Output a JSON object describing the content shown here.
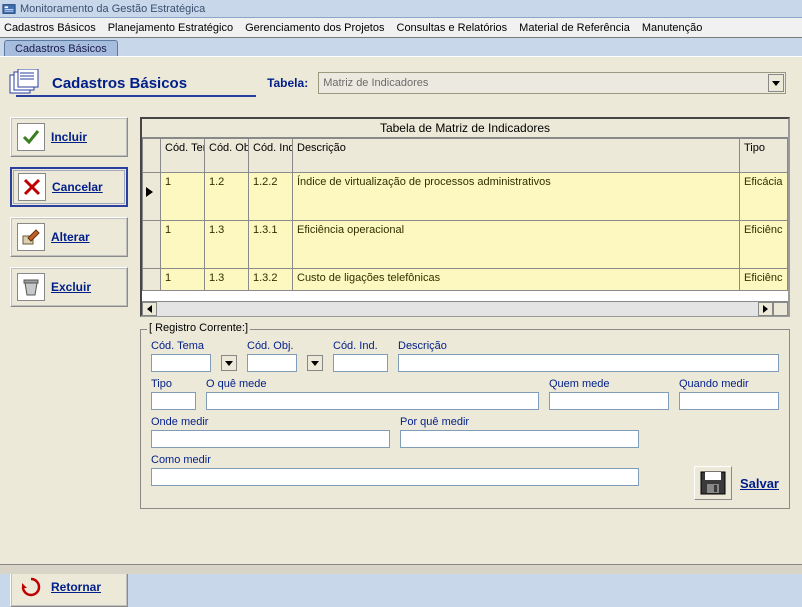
{
  "window": {
    "title": "Monitoramento da Gestão Estratégica"
  },
  "menu": {
    "items": [
      "Cadastros Básicos",
      "Planejamento Estratégico",
      "Gerenciamento dos Projetos",
      "Consultas e Relatórios",
      "Material de Referência",
      "Manutenção"
    ]
  },
  "tabstrip": {
    "active": "Cadastros Básicos"
  },
  "header": {
    "title": "Cadastros Básicos",
    "tabela_label": "Tabela:",
    "tabela_value": "Matriz de Indicadores"
  },
  "actions": {
    "incluir": "Incluir",
    "cancelar": "Cancelar",
    "alterar": "Alterar",
    "excluir": "Excluir",
    "retornar": "Retornar"
  },
  "table": {
    "title": "Tabela de Matriz de Indicadores",
    "columns": {
      "cod_tema": "Cód. Tema",
      "cod_obj": "Cód. Obj.",
      "cod_ind": "Cód. Ind.",
      "descricao": "Descrição",
      "tipo": "Tipo"
    },
    "rows": [
      {
        "cod_tema": "1",
        "cod_obj": "1.2",
        "cod_ind": "1.2.2",
        "descricao": "Índice de virtualização de processos administrativos",
        "tipo": "Eficácia"
      },
      {
        "cod_tema": "1",
        "cod_obj": "1.3",
        "cod_ind": "1.3.1",
        "descricao": "Eficiência operacional",
        "tipo": "Eficiênc"
      },
      {
        "cod_tema": "1",
        "cod_obj": "1.3",
        "cod_ind": "1.3.2",
        "descricao": "Custo de ligações telefônicas",
        "tipo": "Eficiênc"
      }
    ]
  },
  "registro": {
    "legend": "[ Registro Corrente:]",
    "labels": {
      "cod_tema": "Cód. Tema",
      "cod_obj": "Cód. Obj.",
      "cod_ind": "Cód. Ind.",
      "descricao": "Descrição",
      "tipo": "Tipo",
      "o_que_mede": "O quê mede",
      "quem_mede": "Quem mede",
      "quando_medir": "Quando medir",
      "onde_medir": "Onde medir",
      "por_que_medir": "Por quê medir",
      "como_medir": "Como medir"
    },
    "save_label": "Salvar"
  }
}
